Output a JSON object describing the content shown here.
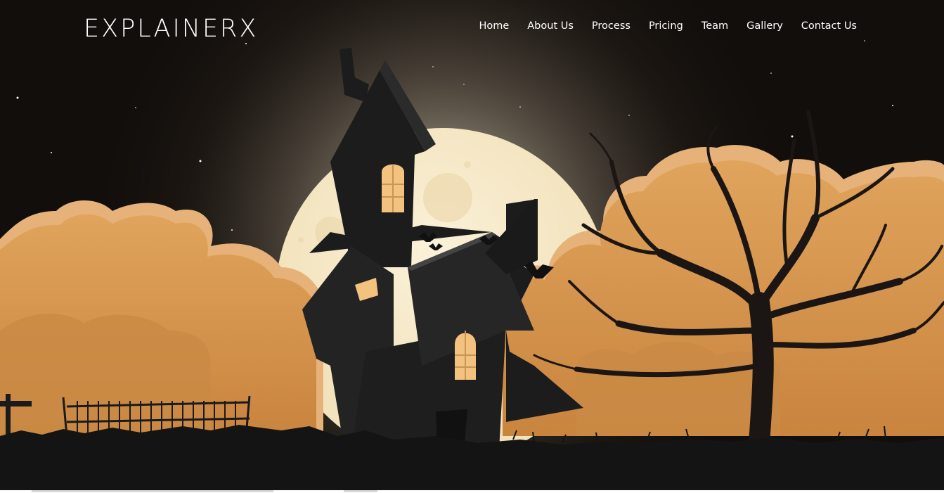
{
  "brand": {
    "logo": "EXPLAINERX"
  },
  "nav": {
    "items": [
      {
        "label": "Home"
      },
      {
        "label": "About Us"
      },
      {
        "label": "Process"
      },
      {
        "label": "Pricing"
      },
      {
        "label": "Team"
      },
      {
        "label": "Gallery"
      },
      {
        "label": "Contact Us"
      }
    ]
  },
  "hero": {
    "illustration": "haunted-house-full-moon-night",
    "colors": {
      "sky": "#120e0b",
      "moon": "#f7ecd3",
      "bushes": "#d9974f",
      "silhouette": "#1c1c1c",
      "window_light": "#f3c27f"
    }
  }
}
